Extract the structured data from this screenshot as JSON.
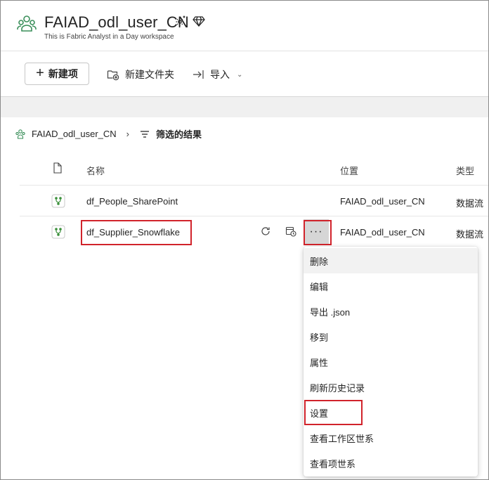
{
  "workspace": {
    "title": "FAIAD_odl_user_CN",
    "subtitle": "This is Fabric Analyst in a Day workspace",
    "icon": "workspace-people-icon",
    "badges": [
      "settings-sparkle-icon",
      "premium-diamond-icon"
    ]
  },
  "toolbar": {
    "new_item_label": "新建项",
    "new_folder_label": "新建文件夹",
    "import_label": "导入"
  },
  "breadcrumb": {
    "workspace": "FAIAD_odl_user_CN",
    "filtered": "筛选的结果"
  },
  "table": {
    "headers": {
      "name": "名称",
      "location": "位置",
      "type": "类型"
    },
    "rows": [
      {
        "name": "df_People_SharePoint",
        "location": "FAIAD_odl_user_CN",
        "type": "数据流"
      },
      {
        "name": "df_Supplier_Snowflake",
        "location": "FAIAD_odl_user_CN",
        "type": "数据流"
      }
    ]
  },
  "menu": {
    "items": [
      "删除",
      "编辑",
      "导出 .json",
      "移到",
      "属性",
      "刷新历史记录",
      "设置",
      "查看工作区世系",
      "查看项世系"
    ]
  },
  "colors": {
    "highlight": "#d1232b",
    "dataflow_icon": "#3a8f3a",
    "workspace_icon": "#3a8f5a"
  }
}
